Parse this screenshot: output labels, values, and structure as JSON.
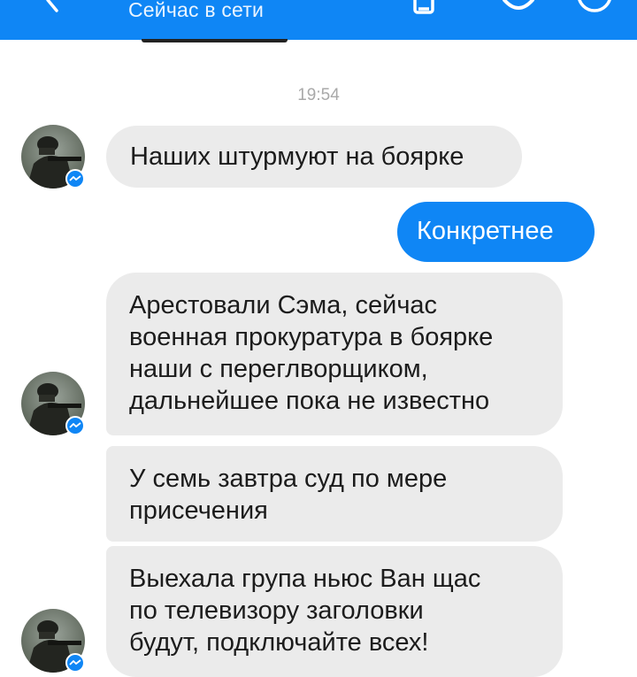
{
  "header": {
    "status": "Сейчас в сети",
    "bg_color": "#0f86f5",
    "back_icon": "chevron-left-icon",
    "phone_icon": "phone-icon",
    "video_icon": "video-camera-icon",
    "info_icon": "info-icon"
  },
  "timestamp": "19:54",
  "messages": [
    {
      "sender": "contact",
      "lines": [
        "Наших штурмуют на боярке"
      ]
    },
    {
      "sender": "me",
      "lines": [
        "Конкретнее"
      ]
    },
    {
      "sender": "contact",
      "lines": [
        "Арестовали Сэма, сейчас",
        "военная прокуратура в боярке",
        "наши с переглворщиком,",
        "дальнейшее пока не известно"
      ]
    },
    {
      "sender": "contact",
      "lines": [
        "У семь завтра суд по мере",
        "присечения"
      ]
    },
    {
      "sender": "contact",
      "lines": [
        "Выехала група ньюс Ван щас",
        "по телевизору заголовки",
        "будут, подключайте всех!"
      ]
    }
  ],
  "colors": {
    "outgoing_bubble": "#0f86f5",
    "incoming_bubble": "#ebebeb",
    "timestamp_text": "#a9a9a9"
  }
}
